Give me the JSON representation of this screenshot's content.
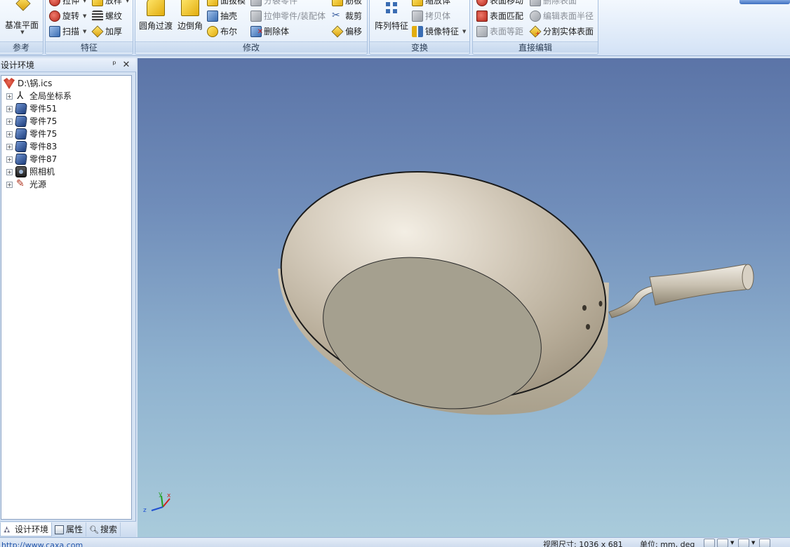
{
  "ribbon": {
    "reference": {
      "label": "参考",
      "datum_plane": "基准平面"
    },
    "feature": {
      "label": "特征",
      "extrude": "拉伸",
      "revolve": "旋转",
      "sweep": "扫描",
      "loft": "放样",
      "helix": "螺纹",
      "thicken": "加厚"
    },
    "modify": {
      "label": "修改",
      "fillet": "圆角过渡",
      "chamfer": "边倒角",
      "face_draft": "面拔模",
      "shell": "抽壳",
      "boolean": "布尔",
      "split_part": "分裂零件",
      "pull_part_assembly": "拉伸零件/装配体",
      "delete_body": "删除体",
      "rib": "筋板",
      "trim": "裁剪",
      "offset": "偏移"
    },
    "transform": {
      "label": "变换",
      "pattern": "阵列特征",
      "scale_body": "缩放体",
      "copy_body": "拷贝体",
      "mirror_feature": "镜像特征"
    },
    "direct_edit": {
      "label": "直接编辑",
      "move_face": "表面移动",
      "delete_face": "删除表面",
      "match_face": "表面匹配",
      "edit_face_radius": "编辑表面半径",
      "face_equidistant": "表面等距",
      "split_solid_face": "分割实体表面"
    }
  },
  "panel": {
    "title": "设计环境",
    "pin_icon": "pin-icon",
    "close_icon": "close-icon",
    "tree": {
      "root": "D:\\锅.ics",
      "items": [
        {
          "label": "全局坐标系",
          "icon": "axes-icon"
        },
        {
          "label": "零件51",
          "icon": "part-icon"
        },
        {
          "label": "零件75",
          "icon": "part-icon"
        },
        {
          "label": "零件75",
          "icon": "part-icon"
        },
        {
          "label": "零件83",
          "icon": "part-icon"
        },
        {
          "label": "零件87",
          "icon": "part-icon"
        },
        {
          "label": "照相机",
          "icon": "camera-icon"
        },
        {
          "label": "光源",
          "icon": "light-icon"
        }
      ]
    },
    "tabs": {
      "design_env": "设计环境",
      "properties": "属性",
      "search": "搜索"
    }
  },
  "viewport": {
    "axis_x": "x",
    "axis_y": "y",
    "axis_z": "z",
    "background_top": "#5b74a7",
    "background_bottom": "#a9cbdb"
  },
  "status": {
    "url": "http://www.caxa.com",
    "view_size": "视图尺寸: 1036 x 681",
    "units": "单位: mm, deg"
  }
}
